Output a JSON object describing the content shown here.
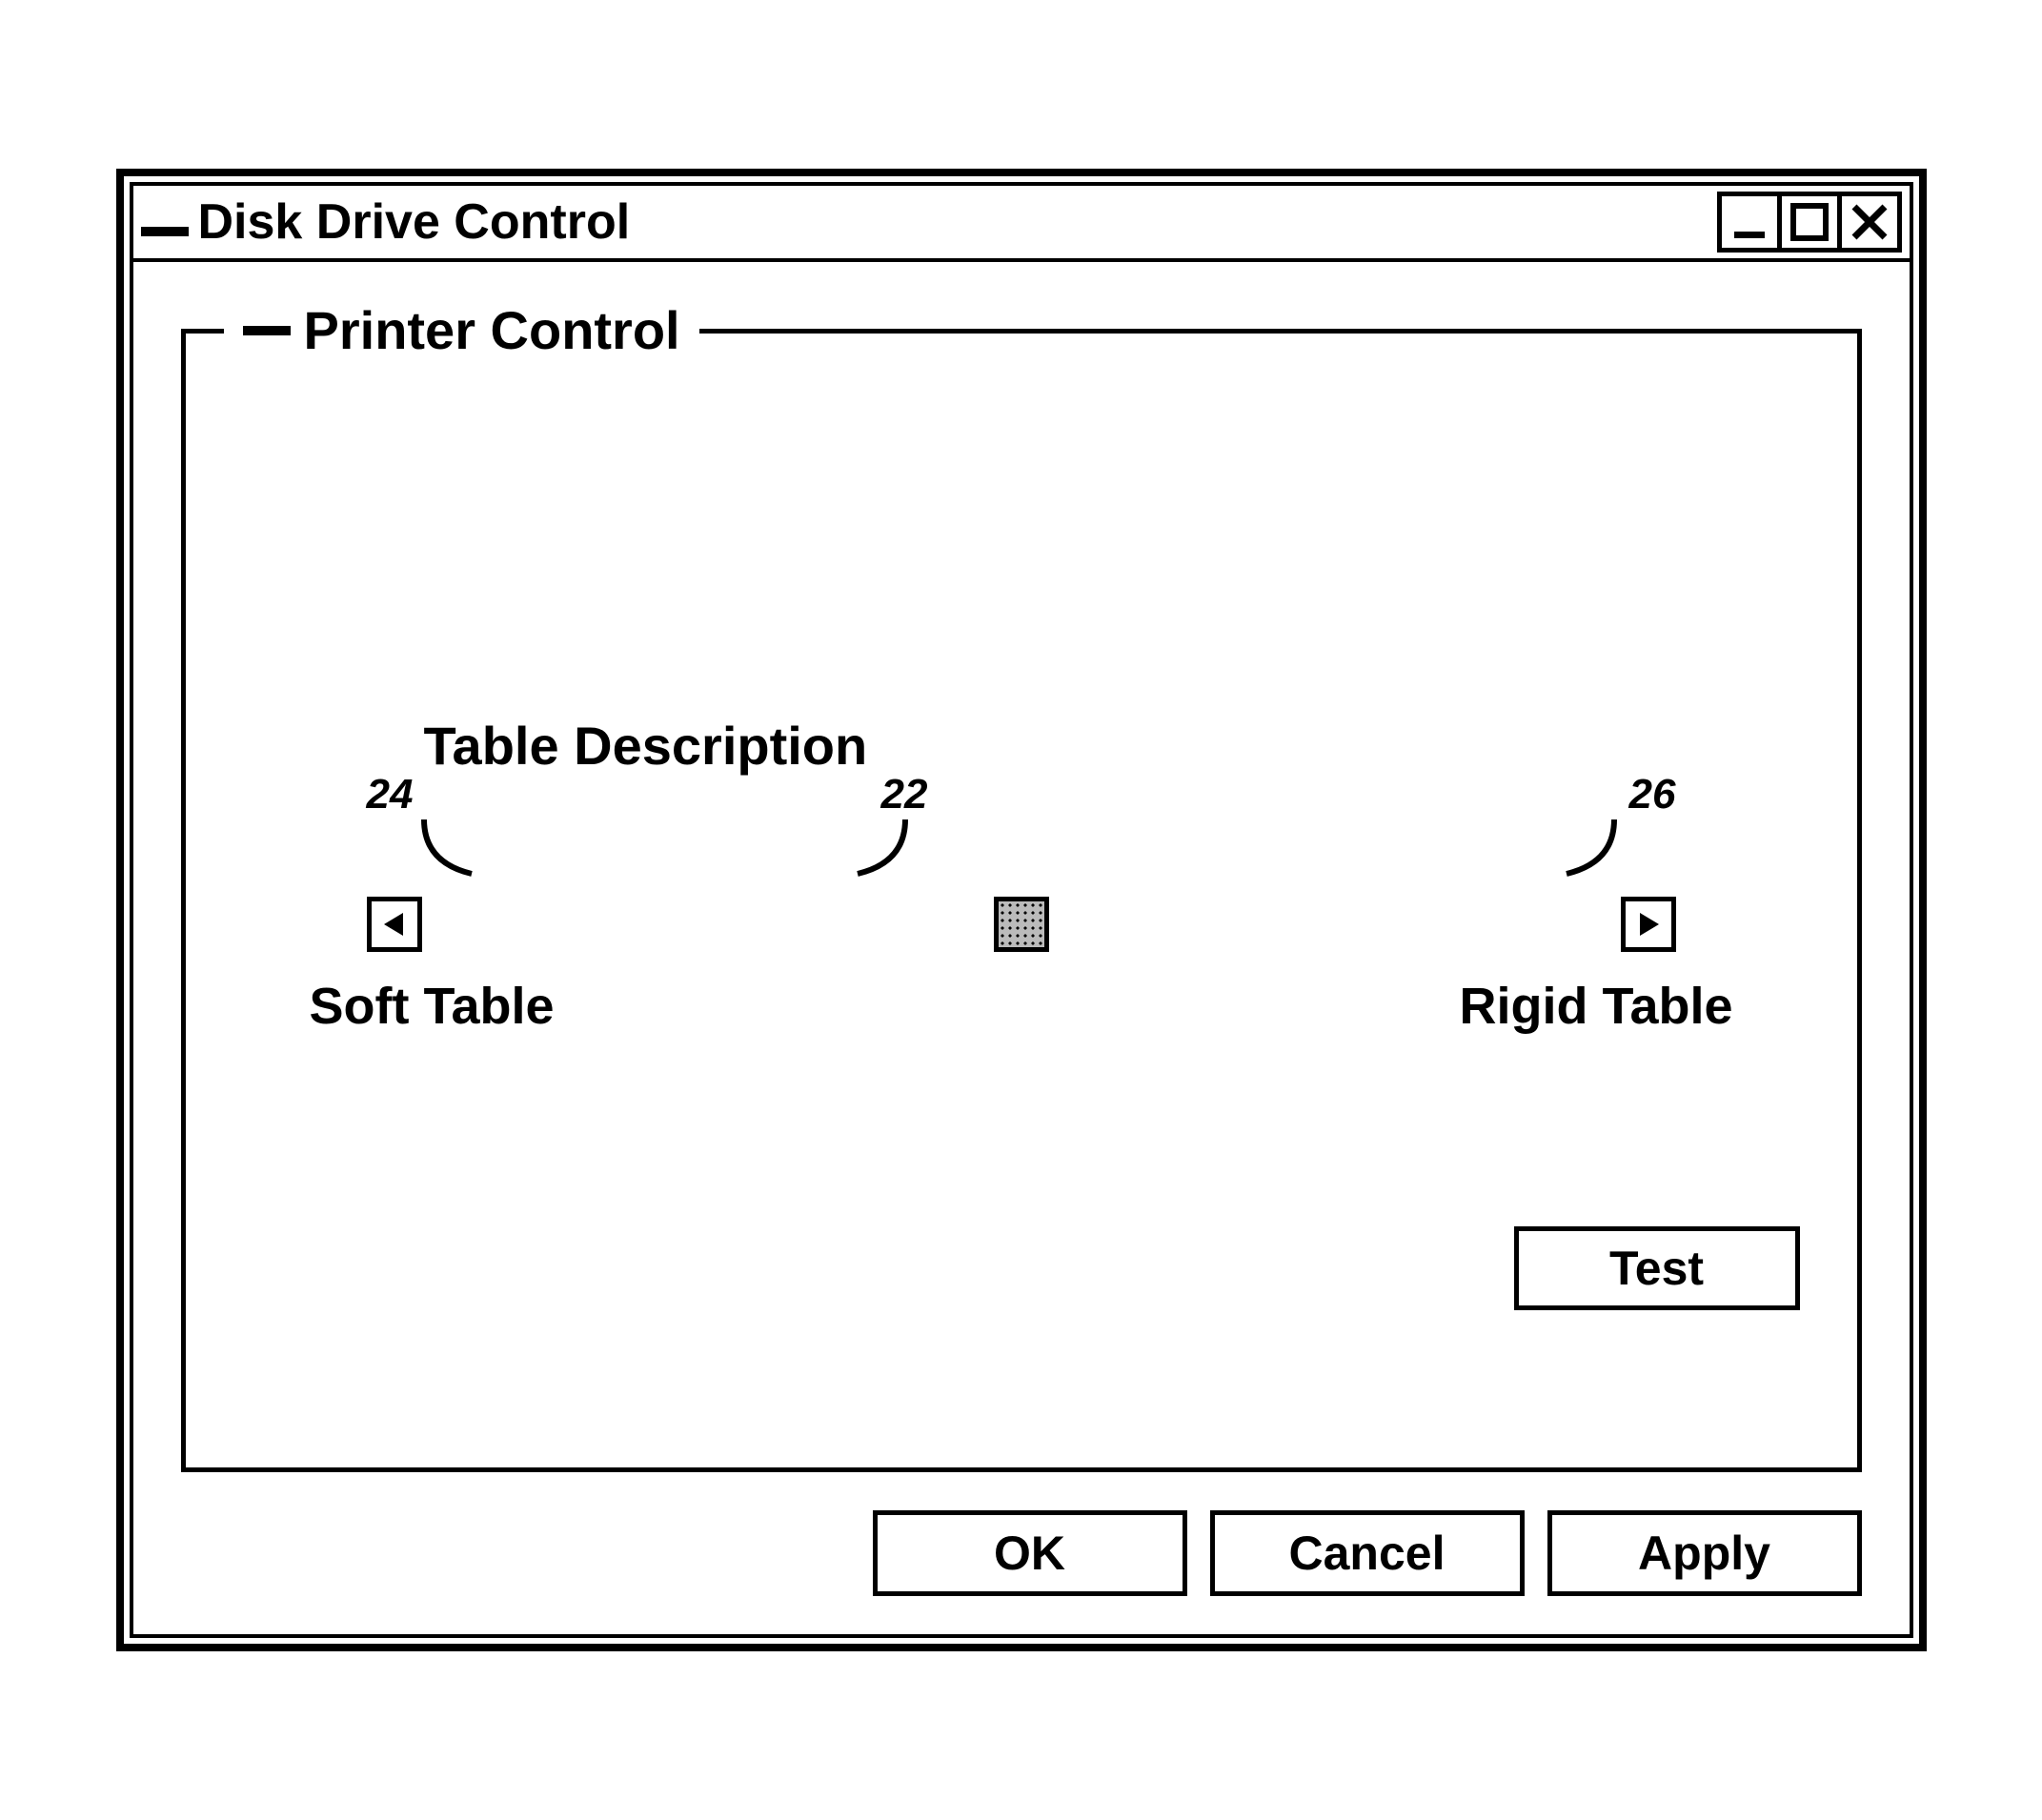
{
  "window": {
    "title": "Disk Drive Control"
  },
  "panel": {
    "legend": "Printer Control",
    "slider_heading": "Table Description",
    "label_left": "Soft Table",
    "label_right": "Rigid Table",
    "test_label": "Test"
  },
  "callouts": {
    "left": "24",
    "thumb": "22",
    "right": "26"
  },
  "footer": {
    "ok": "OK",
    "cancel": "Cancel",
    "apply": "Apply"
  }
}
